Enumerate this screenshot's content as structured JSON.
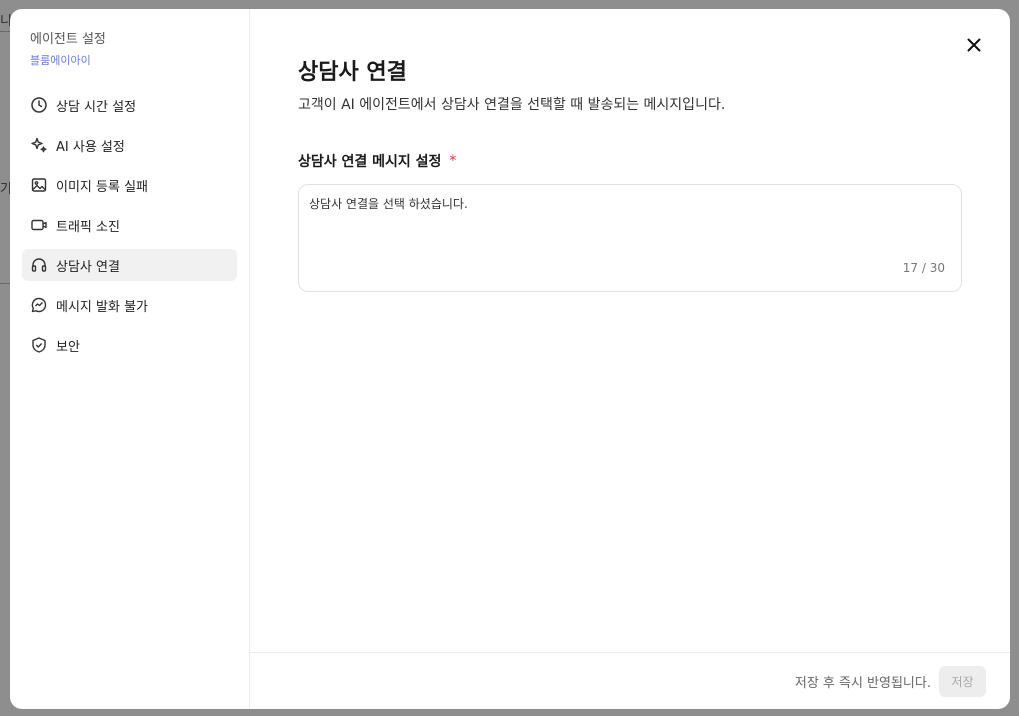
{
  "backdrop": {
    "fragment_top": "니",
    "fragment_mid": "기"
  },
  "sidebar": {
    "title": "에이전트 설정",
    "subtitle": "블룸에이아이",
    "items": [
      {
        "label": "상담 시간 설정",
        "icon": "clock-icon",
        "active": false
      },
      {
        "label": "AI 사용 설정",
        "icon": "sparkle-icon",
        "active": false
      },
      {
        "label": "이미지 등록 실패",
        "icon": "image-icon",
        "active": false
      },
      {
        "label": "트래픽 소진",
        "icon": "video-icon",
        "active": false
      },
      {
        "label": "상담사 연결",
        "icon": "headset-icon",
        "active": true
      },
      {
        "label": "메시지 발화 불가",
        "icon": "chat-bubble-icon",
        "active": false
      },
      {
        "label": "보안",
        "icon": "shield-check-icon",
        "active": false
      }
    ]
  },
  "main": {
    "title": "상담사 연결",
    "description": "고객이 AI 에이전트에서 상담사 연결을 선택할 때 발송되는 메시지입니다.",
    "field_label": "상담사 연결 메시지 설정",
    "required_mark": "*",
    "message_value": "상담사 연결을 선택 하셨습니다.",
    "counter": "17 / 30"
  },
  "footer": {
    "note": "저장 후 즉시 반영됩니다.",
    "save_label": "저장"
  },
  "colors": {
    "accent_sub": "#6b7fd8",
    "required": "#d93b3b",
    "active_bg": "#f1f1f1"
  }
}
